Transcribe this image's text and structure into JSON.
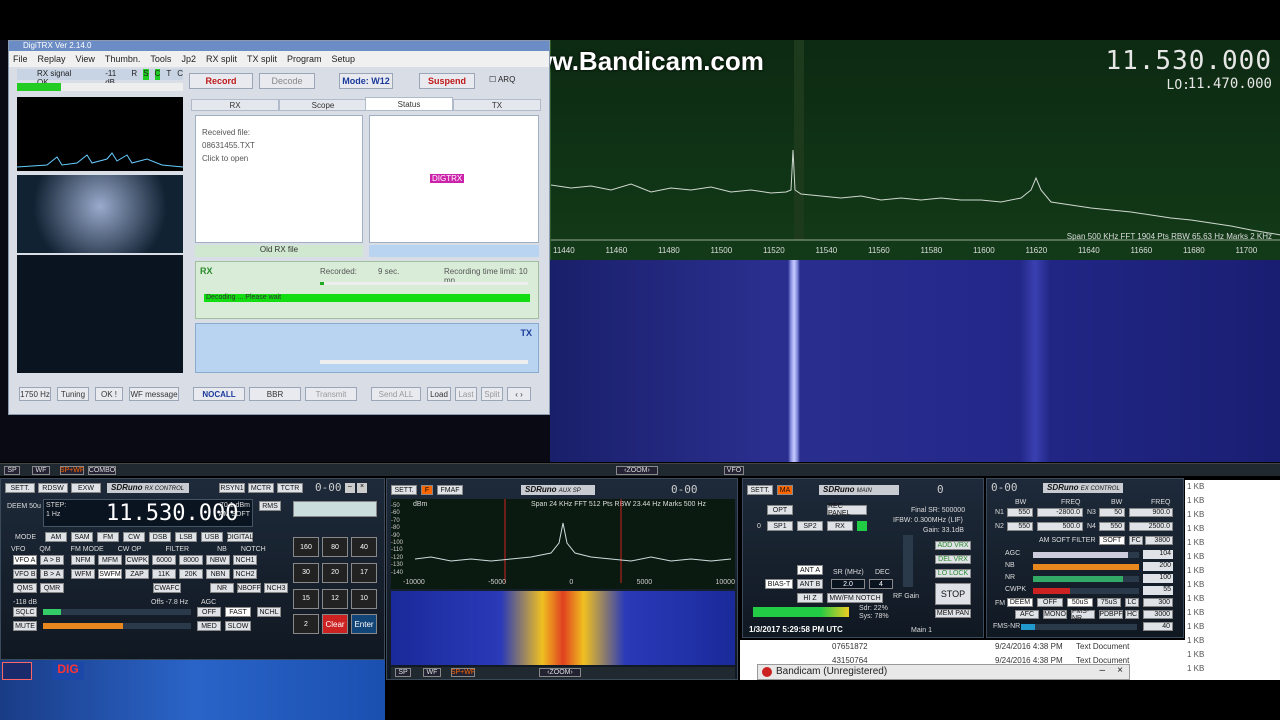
{
  "watermark": "www.Bandicam.com",
  "spectrum": {
    "frequency": "11.530.000",
    "lo_label": "LO:",
    "lo_value": "11.470.000",
    "info": "Span 500 KHz   FFT 1904 Pts   RBW 65.63 Hz   Marks 2 KHz",
    "ticks": [
      "11440",
      "11460",
      "11480",
      "11500",
      "11520",
      "11540",
      "11560",
      "11580",
      "11600",
      "11620",
      "11640",
      "11660",
      "11680",
      "11700"
    ]
  },
  "digitrx": {
    "title": "DigiTRX  Ver 2.14.0",
    "menu": [
      "File",
      "Replay",
      "View",
      "Thumbn.",
      "Tools",
      "Jp2",
      "RX split",
      "TX split",
      "Program",
      "Setup"
    ],
    "rx_signal": "RX signal OK",
    "rx_db": "-11 dB",
    "flags": [
      "R",
      "S",
      "C",
      "T",
      "C"
    ],
    "record": "Record",
    "decode": "Decode",
    "mode": "Mode: W12",
    "suspend": "Suspend",
    "arq": "ARQ",
    "tabs": [
      "RX",
      "Scope",
      "Status",
      "TX"
    ],
    "received_file": "Received file:",
    "file_name": "08631455.TXT",
    "click_open": "Click to open",
    "logo": "DIGTRX",
    "old_rx": "Old RX file",
    "rx_label": "RX",
    "recorded_label": "Recorded:",
    "recorded_val": "9 sec.",
    "limit": "Recording time limit: 10 mn",
    "decoding": "Decoding ... Please wait",
    "tx_label": "TX",
    "bottom": [
      "1750 Hz",
      "Tuning",
      "OK !",
      "WF message",
      "NOCALL",
      "BBR",
      "Transmit",
      "Send ALL",
      "Load",
      "Last",
      "Split"
    ]
  },
  "sdr_tabs": {
    "left": [
      "SP",
      "WF",
      "SP+WF",
      "COMBO"
    ],
    "zoom": "ZOOM",
    "vfo": "VFO"
  },
  "rx_control": {
    "buttons_top": [
      "SETT.",
      "RDSW",
      "EXW"
    ],
    "title": "SDRuno",
    "subtitle": "RX CONTROL",
    "buttons_top2": [
      "RSYN1",
      "MCTR",
      "TCTR"
    ],
    "digits": "0-00",
    "deem": "DEEM 50u",
    "step_label": "STEP:",
    "step_val": "1 Hz",
    "freq": "11.530.000",
    "db": "-70.1 dBm",
    "agc": "AM SOFT",
    "rms": "RMS",
    "mode_label": "MODE",
    "modes": [
      "AM",
      "SAM",
      "FM",
      "CW",
      "DSB",
      "LSB",
      "USB",
      "DIGITAL"
    ],
    "vfo_label": "VFO",
    "qm": "QM",
    "fm_mode": "FM MODE",
    "cw_op": "CW OP",
    "filter": "FILTER",
    "nb": "NB",
    "notch": "NOTCH",
    "row2": [
      "VFO A",
      "A > B",
      "NFM",
      "MFM",
      "CWPK",
      "6000",
      "8000",
      "NBW",
      "NCH1"
    ],
    "row3": [
      "VFO B",
      "B > A",
      "WFM",
      "SWFM",
      "ZAP",
      "11K",
      "20K",
      "NBN",
      "NCH2"
    ],
    "row4": [
      "QMS",
      "QMR",
      "CWAFC",
      "NR",
      "NBOFF",
      "NCH3"
    ],
    "level": "-118 dB",
    "offs": "Offs -7.8 Hz",
    "agc_label": "AGC",
    "sqlc": "SQLC",
    "off": "OFF",
    "fast": "FAST",
    "nchl": "NCHL",
    "mute": "MUTE",
    "med": "MED",
    "slow": "SLOW",
    "keypad": [
      "160",
      "80",
      "40",
      "30",
      "20",
      "17",
      "15",
      "12",
      "10",
      "2",
      "Clear",
      "Enter"
    ]
  },
  "aux_sp": {
    "sett": "SETT.",
    "f": "F",
    "fmaf": "FMAF",
    "title": "SDRuno",
    "subtitle": "AUX SP",
    "digits": "0-00",
    "info": "Span 24 KHz   FFT 512 Pts   RBW 23.44 Hz   Marks 500 Hz",
    "dbm": "dBm",
    "yticks": [
      "-50",
      "-60",
      "-70",
      "-80",
      "-90",
      "-100",
      "-110",
      "-120",
      "-130",
      "-140"
    ],
    "xticks": [
      "-10000",
      "-5000",
      "0",
      "5000",
      "10000"
    ],
    "bottom": [
      "SP",
      "WF",
      "SP+WF"
    ]
  },
  "main": {
    "sett": "SETT.",
    "ma": "MA",
    "title": "SDRuno",
    "subtitle": "MAIN",
    "digits": "0",
    "opt": "OPT",
    "rec": "REC PANEL",
    "sp1": "SP1",
    "sp2": "SP2",
    "rx": "RX",
    "final_sr": "Final SR: 500000",
    "ifbw": "IFBW: 0.300MHz (LIF)",
    "gain": "Gain: 33.1dB",
    "ant_a": "ANT A",
    "ant_b": "ANT B",
    "bias": "BIAS-T",
    "hiz": "HI Z",
    "sr_label": "SR (MHz)",
    "sr_val": "2.0",
    "dec_label": "DEC",
    "dec_val": "4",
    "mw": "MW/FM NOTCH",
    "rf_gain": "RF Gain",
    "add": "ADD VRX",
    "del": "DEL VRX",
    "lo_lock": "LO LOCK",
    "stop": "STOP",
    "mem": "MEM PAN",
    "sdr": "Sdr: 22%",
    "sys": "Sys: 78%",
    "date": "1/3/2017 5:29:58 PM UTC",
    "main1": "Main 1",
    "zero": "0"
  },
  "ex_control": {
    "digits": "0-00",
    "title": "SDRuno",
    "subtitle": "EX CONTROL",
    "bw": "BW",
    "freq": "FREQ",
    "n1": "N1",
    "n1_bw": "550",
    "n1_freq": "-2800.0",
    "n3": "N3",
    "n3_bw": "50",
    "n3_freq": "900.0",
    "n2": "N2",
    "n2_bw": "550",
    "n2_freq": "500.0",
    "n4": "N4",
    "n4_bw": "550",
    "n4_freq": "2500.0",
    "am_soft": "AM SOFT FILTER",
    "soft": "SOFT",
    "fc": "FC",
    "fc_val": "3800",
    "sliders": [
      {
        "label": "AGC",
        "val": "104"
      },
      {
        "label": "NB",
        "val": "200"
      },
      {
        "label": "NR",
        "val": "100"
      },
      {
        "label": "CWPK",
        "val": "55"
      }
    ],
    "fm": "FM",
    "deem": "DEEM",
    "off": "OFF",
    "u50": "50uS",
    "u75": "75uS",
    "lc": "LC",
    "lc_val": "300",
    "afc": "AFC",
    "mono": "MONO",
    "fmsnr": "FMS-NR",
    "pdbpf": "PDBPF",
    "hc": "HC",
    "hc_val": "3000",
    "fmsnr_label": "FMS-NR",
    "fmsnr_val": "40"
  },
  "files": {
    "sizes": [
      "1 KB",
      "1 KB",
      "1 KB",
      "1 KB",
      "1 KB",
      "1 KB",
      "1 KB",
      "1 KB",
      "1 KB",
      "1 KB",
      "1 KB",
      "1 KB",
      "1 KB",
      "1 KB"
    ],
    "rows": [
      {
        "name": "07651872",
        "date": "9/24/2016 4:38 PM",
        "type": "Text Document"
      },
      {
        "name": "43150764",
        "date": "9/24/2016 4:38 PM",
        "type": "Text Document"
      }
    ]
  },
  "bandicam_bar": "Bandicam (Unregistered)",
  "taskbar_icon": "DIG"
}
